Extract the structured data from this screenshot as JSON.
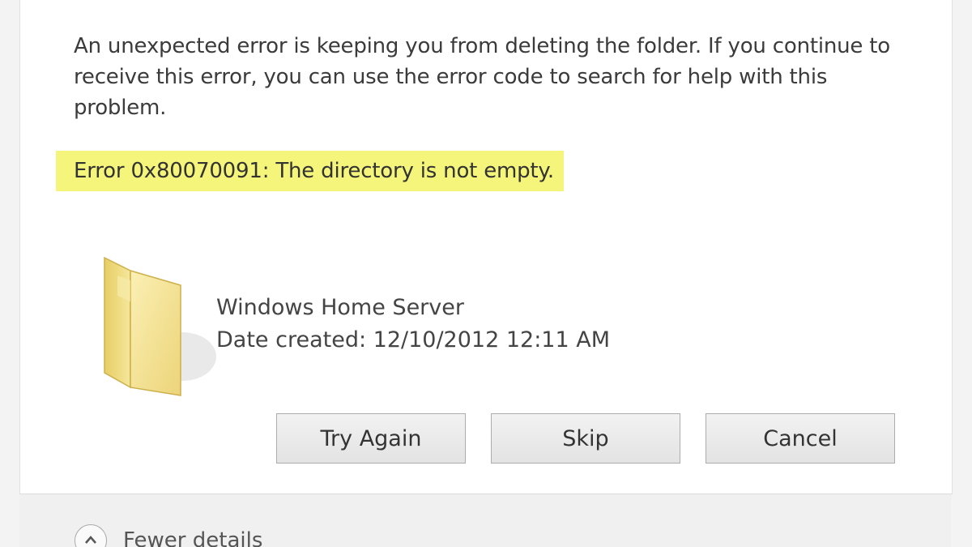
{
  "dialog": {
    "message": "An unexpected error is keeping you from deleting the folder. If you continue to receive this error, you can use the error code to search for help with this problem.",
    "error_text": "Error 0x80070091: The directory is not empty.",
    "highlight_color": "#f4f57a",
    "item": {
      "icon": "folder-icon",
      "name": "Windows Home Server",
      "date_created": "Date created: 12/10/2012 12:11 AM"
    },
    "buttons": {
      "try_again": "Try Again",
      "skip": "Skip",
      "cancel": "Cancel"
    }
  },
  "footer": {
    "toggle_icon": "chevron-up-icon",
    "fewer_details": "Fewer details"
  }
}
